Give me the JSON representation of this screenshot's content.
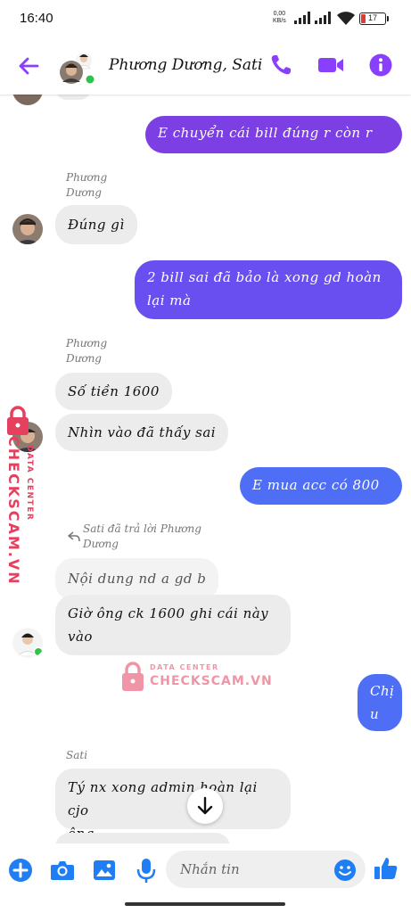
{
  "status_bar": {
    "time": "16:40",
    "net_speed_value": "0,00",
    "net_speed_unit": "KB/s",
    "battery_level": "17"
  },
  "header": {
    "title": "Phương Dương, Sati",
    "icons": [
      "back-arrow-icon",
      "phone-icon",
      "video-camera-icon",
      "info-icon"
    ],
    "accent_color": "#8a3ffc"
  },
  "messages": [
    {
      "direction": "outgoing",
      "text": "E chuyển cái bill đúng r còn r"
    },
    {
      "direction": "incoming",
      "sender_line1": "Phương",
      "sender_line2": "Dương",
      "text": "Đúng gì"
    },
    {
      "direction": "outgoing",
      "line1": "2 bill sai đã bảo là xong gd hoàn",
      "line2": "lại mà"
    },
    {
      "direction": "incoming",
      "sender_line1": "Phương",
      "sender_line2": "Dương",
      "text": "Số tiền 1600"
    },
    {
      "direction": "incoming",
      "text": "Nhìn vào đã thấy sai"
    },
    {
      "direction": "outgoing",
      "text": "E mua acc có 800"
    },
    {
      "direction": "incoming",
      "reply_line1": "Sati đã trả lời Phương",
      "reply_line2": "Dương",
      "quoted_text": "Nội dung nd a gd b",
      "line1": "Giờ ông ck 1600 ghi cái này",
      "line2": "vào"
    },
    {
      "direction": "outgoing",
      "line1": "Chị",
      "line2": "u"
    },
    {
      "direction": "incoming",
      "sender_line1": "Sati",
      "line1": "Tý nx xong admin hoàn lại cjo",
      "line2": "ông"
    }
  ],
  "watermark": {
    "brand": "CHECKSCAM.VN",
    "subtitle": "DATA CENTER"
  },
  "composer": {
    "placeholder": "Nhắn tin",
    "icons": [
      "add-circle-icon",
      "camera-icon",
      "image-icon",
      "microphone-icon",
      "emoji-icon",
      "thumbs-up-icon"
    ]
  },
  "colors": {
    "outgoing_purple": "#7b3fe4",
    "outgoing_blue": "#4d6ef5",
    "incoming_gray": "#ececec",
    "composer_blue": "#1f7ef3"
  }
}
